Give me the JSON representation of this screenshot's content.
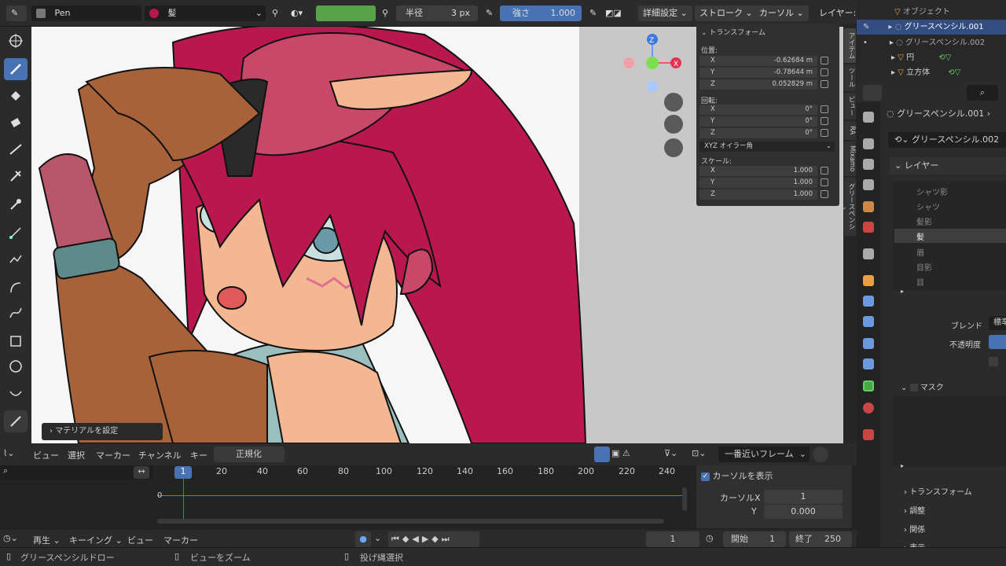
{
  "topbar": {
    "mode": "Pen",
    "material": "髪",
    "radius_label": "半径",
    "radius_value": "3 px",
    "strength_label": "強さ",
    "strength_value": "1.000",
    "advanced": "詳細設定",
    "stroke": "ストローク",
    "cursor": "カーソル",
    "layer": "レイヤー:"
  },
  "transform_panel": {
    "title": "トランスフォーム",
    "location_label": "位置:",
    "location": [
      {
        "axis": "X",
        "value": "-0.62684 m"
      },
      {
        "axis": "Y",
        "value": "-0.78644 m"
      },
      {
        "axis": "Z",
        "value": "0.052829 m"
      }
    ],
    "rotation_label": "回転:",
    "rotation": [
      {
        "axis": "X",
        "value": "0°"
      },
      {
        "axis": "Y",
        "value": "0°"
      },
      {
        "axis": "Z",
        "value": "0°"
      }
    ],
    "rotation_mode": "XYZ オイラー角",
    "scale_label": "スケール:",
    "scale": [
      {
        "axis": "X",
        "value": "1.000"
      },
      {
        "axis": "Y",
        "value": "1.000"
      },
      {
        "axis": "Z",
        "value": "1.000"
      }
    ]
  },
  "side_tabs": [
    "アイテム",
    "ツール",
    "ビュー",
    "RA",
    "Mixamo",
    "グリースペンシル"
  ],
  "viewport": {
    "hint": "マテリアルを設定",
    "gizmo": {
      "x": "X",
      "z": "Z"
    }
  },
  "outliner": {
    "items": [
      "オブジェクト",
      "グリースペンシル.001",
      "グリースペンシル.002",
      "円",
      "立方体"
    ]
  },
  "properties": {
    "object_name": "グリースペンシル.001",
    "data_name": "グリースペンシル.002",
    "layers_header": "レイヤー",
    "layers": [
      "シャツ影",
      "シャツ",
      "髪影",
      "髪",
      "眉",
      "目影",
      "目"
    ],
    "active_layer": "髪",
    "blend_label": "ブレンド",
    "blend_value": "標準",
    "opacity_label": "不透明度",
    "mask_label": "マスク",
    "sections": [
      "トランスフォーム",
      "調整",
      "関係",
      "表示"
    ]
  },
  "timeline": {
    "menus": [
      "ビュー",
      "選択",
      "マーカー",
      "チャンネル",
      "キー"
    ],
    "normalize": "正規化",
    "snap": "一番近いフレーム",
    "current_frame_marker": "1",
    "frames": [
      "20",
      "40",
      "60",
      "80",
      "100",
      "120",
      "140",
      "160",
      "180",
      "200",
      "220",
      "240"
    ],
    "channel_value": "0",
    "cursor_panel": {
      "title": "カーソルを表示",
      "cursor_x_label": "カーソルX",
      "cursor_x_value": "1",
      "y_label": "Y",
      "y_value": "0.000"
    }
  },
  "playback": {
    "play_menu": "再生",
    "keying_menu": "キーイング",
    "view_menu": "ビュー",
    "marker_menu": "マーカー",
    "current_frame": "1",
    "start_label": "開始",
    "start_value": "1",
    "end_label": "終了",
    "end_value": "250"
  },
  "statusbar": {
    "left": "グリースペンシルドロー",
    "middle": "ビューをズーム",
    "right": "投げ縄選択"
  },
  "colors": {
    "accent": "#4772b3",
    "hair": "#b8184e",
    "skin": "#f3b891",
    "jacket": "#a8623a"
  }
}
